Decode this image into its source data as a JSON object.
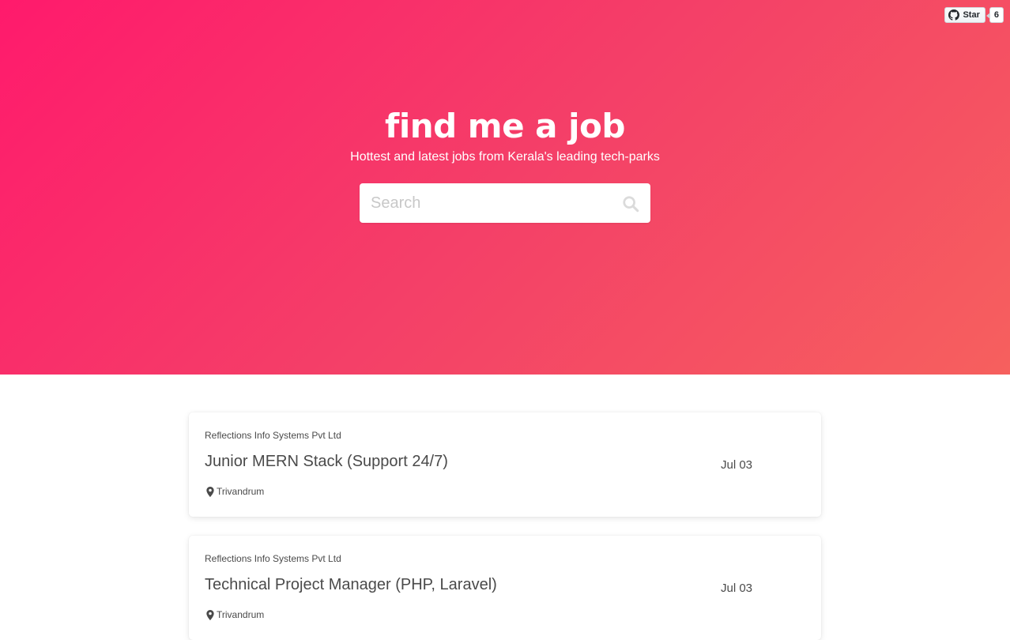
{
  "github": {
    "star_label": "Star",
    "star_count": "6"
  },
  "hero": {
    "brand": "find me a job",
    "tagline": "Hottest and latest jobs from Kerala's leading tech-parks",
    "search_placeholder": "Search"
  },
  "jobs": [
    {
      "company": "Reflections Info Systems Pvt Ltd",
      "title": "Junior MERN Stack (Support 24/7)",
      "date": "Jul 03",
      "location": "Trivandrum"
    },
    {
      "company": "Reflections Info Systems Pvt Ltd",
      "title": "Technical Project Manager (PHP, Laravel)",
      "date": "Jul 03",
      "location": "Trivandrum"
    }
  ],
  "icons": {
    "github": "github-icon",
    "search": "search-icon",
    "location": "map-marker-icon"
  },
  "colors": {
    "hero_start": "#ff1a6c",
    "hero_end": "#f6605e",
    "text": "#4a4a4a"
  }
}
